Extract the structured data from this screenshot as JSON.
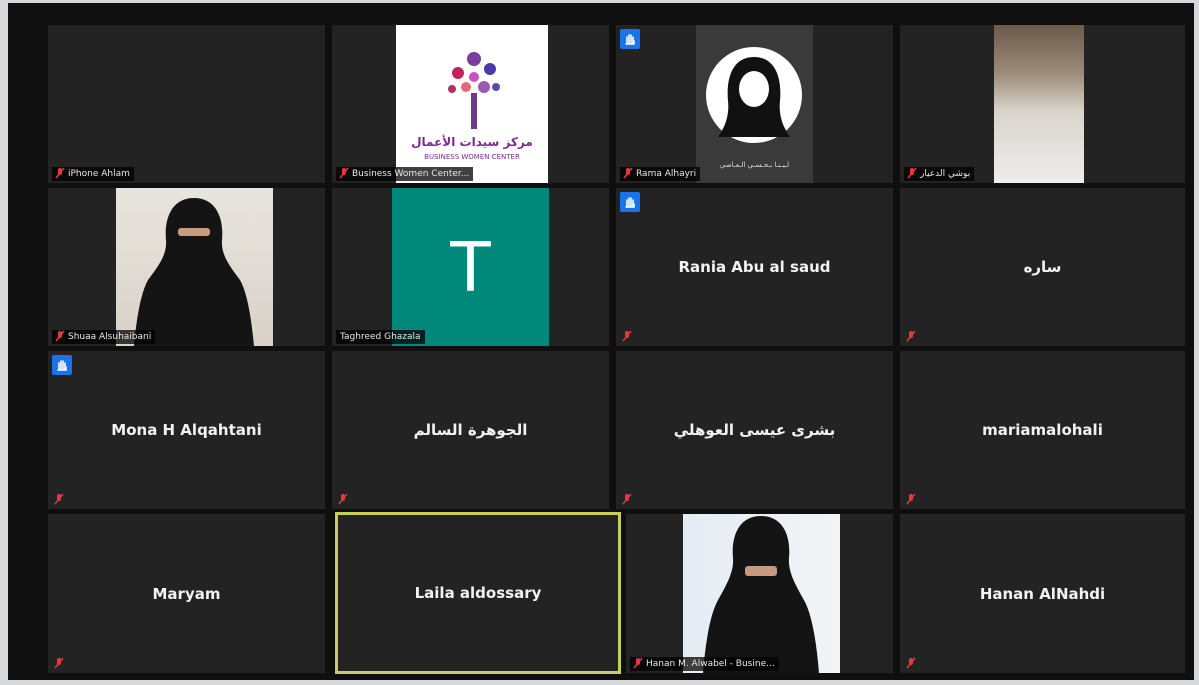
{
  "participants": [
    {
      "name": "iPhone Ahlam",
      "style": "label",
      "muted": true,
      "hand": false,
      "video": "blank"
    },
    {
      "name": "Business Women Center...",
      "style": "label",
      "muted": true,
      "hand": false,
      "video": "logo",
      "logo_text": "مركز سيدات الأعمال",
      "logo_subtext": "BUSINESS WOMEN CENTER"
    },
    {
      "name": "Rama Alhayri",
      "style": "label",
      "muted": true,
      "hand": true,
      "video": "avatar",
      "caption": "لـيـنـا بـحـسـي الـعـاصي"
    },
    {
      "name": "بوشي الدعيار",
      "style": "label",
      "muted": true,
      "hand": false,
      "video": "room"
    },
    {
      "name": "Shuaa Alsuhaibani",
      "style": "label",
      "muted": true,
      "hand": false,
      "video": "person"
    },
    {
      "name": "Taghreed Ghazala",
      "style": "label-nomute",
      "muted": false,
      "hand": false,
      "video": "letter",
      "letter": "T"
    },
    {
      "name": "Rania Abu al saud",
      "style": "center",
      "muted": true,
      "hand": true
    },
    {
      "name": "ساره",
      "style": "center",
      "muted": true,
      "hand": false
    },
    {
      "name": "Mona H Alqahtani",
      "style": "center",
      "muted": true,
      "hand": true
    },
    {
      "name": "الجوهرة السالم",
      "style": "center",
      "muted": true,
      "hand": false
    },
    {
      "name": "بشرى عيسى العوهلي",
      "style": "center",
      "muted": true,
      "hand": false
    },
    {
      "name": "mariamalohali",
      "style": "center",
      "muted": true,
      "hand": false
    },
    {
      "name": "Maryam",
      "style": "center",
      "muted": true,
      "hand": false
    },
    {
      "name": "Laila aldossary",
      "style": "center",
      "muted": false,
      "hand": false,
      "active": true
    },
    {
      "name": "Hanan M. Alwabel - Busine...",
      "style": "label",
      "muted": true,
      "hand": false,
      "video": "person2"
    },
    {
      "name": "Hanan AlNahdi",
      "style": "center",
      "muted": true,
      "hand": false
    }
  ],
  "colors": {
    "tile_bg": "#232323",
    "active_border": "#c7cf5a",
    "hand_badge": "#1a73e8",
    "mute_icon": "#e5383b",
    "letter_tile": "#00897b"
  }
}
